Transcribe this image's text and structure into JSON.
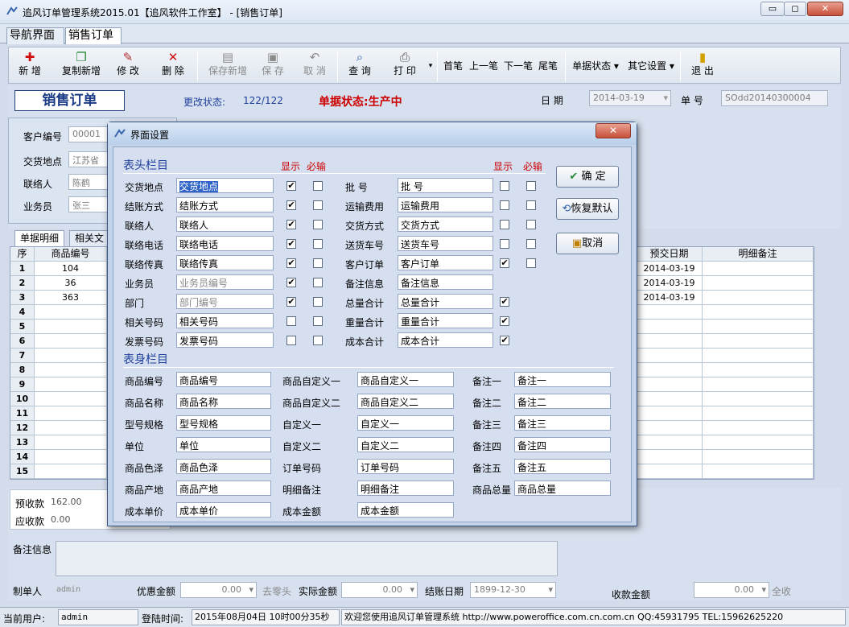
{
  "window": {
    "title": "追风订单管理系统2015.01【追风软件工作室】 - [销售订单]",
    "min": "▭",
    "max": "◻",
    "close": "✕"
  },
  "tabs": [
    "导航界面",
    "销售订单"
  ],
  "toolbar": {
    "add": "新 增",
    "copy_add": "复制新增",
    "edit": "修 改",
    "delete": "删 除",
    "save_add": "保存新增",
    "save": "保 存",
    "cancel": "取 消",
    "query": "查 询",
    "print": "打 印",
    "first": "首笔",
    "prev": "上一笔",
    "next": "下一笔",
    "last": "尾笔",
    "doc_status": "单据状态 ▾",
    "other_settings": "其它设置 ▾",
    "exit": "退 出"
  },
  "header": {
    "order_title": "销售订单",
    "change_status_label": "更改状态:",
    "change_status_value": "122/122",
    "doc_status": "单据状态:生产中",
    "date_label": "日  期",
    "date_value": "2014-03-19",
    "doc_no_label": "单  号",
    "doc_no_value": "SOdd20140300004",
    "fields": [
      {
        "label": "客户编号",
        "value": "00001"
      },
      {
        "label": "交货地点",
        "value": "江苏省"
      },
      {
        "label": "联络人",
        "value": "陈鹤"
      },
      {
        "label": "业务员",
        "value": "张三"
      }
    ]
  },
  "grid": {
    "tabs": [
      "单据明细",
      "相关文"
    ],
    "columns": {
      "seq": "序",
      "code": "商品编号",
      "delivery_date": "预交日期",
      "remark": "明细备注"
    },
    "rows": [
      {
        "seq": "1",
        "code": "104",
        "date": "2014-03-19"
      },
      {
        "seq": "2",
        "code": "36",
        "date": "2014-03-19"
      },
      {
        "seq": "3",
        "code": "363",
        "date": "2014-03-19"
      },
      {
        "seq": "4",
        "code": "",
        "date": ""
      },
      {
        "seq": "5",
        "code": "",
        "date": ""
      },
      {
        "seq": "6",
        "code": "",
        "date": ""
      },
      {
        "seq": "7",
        "code": "",
        "date": ""
      },
      {
        "seq": "8",
        "code": "",
        "date": ""
      },
      {
        "seq": "9",
        "code": "",
        "date": ""
      },
      {
        "seq": "10",
        "code": "",
        "date": ""
      },
      {
        "seq": "11",
        "code": "",
        "date": ""
      },
      {
        "seq": "12",
        "code": "",
        "date": ""
      },
      {
        "seq": "13",
        "code": "",
        "date": ""
      },
      {
        "seq": "14",
        "code": "",
        "date": ""
      },
      {
        "seq": "15",
        "code": "",
        "date": ""
      }
    ]
  },
  "footer": {
    "prepaid_label": "预收款",
    "prepaid_value": "162.00",
    "receivable_label": "应收款",
    "receivable_value": "0.00",
    "remark_label": "备注信息",
    "maker_label": "制单人",
    "maker_value": "admin",
    "discount_label": "优惠金额",
    "discount_value": "0.00",
    "round_label": "去零头",
    "actual_label": "实际金额",
    "actual_value": "0.00",
    "settle_date_label": "结账日期",
    "settle_date_value": "1899-12-30",
    "receipt_label": "收款金额",
    "receipt_value": "0.00",
    "all_receive": "全收"
  },
  "status": {
    "user_label": "当前用户:",
    "user_value": "admin",
    "login_label": "登陆时间:",
    "login_value": "2015年08月04日 10时00分35秒",
    "welcome": "欢迎您使用追风订单管理系统 http://www.poweroffice.com.cn.com.cn QQ:45931795 TEL:15962625220"
  },
  "dialog": {
    "title": "界面设置",
    "close": "✕",
    "head_section": "表头栏目",
    "body_section": "表身栏目",
    "show": "显示",
    "required": "必输",
    "ok": "确 定",
    "restore": "恢复默认",
    "cancel": "取消",
    "left_rows": [
      {
        "label": "交货地点",
        "value": "交货地点",
        "show": true,
        "req": false,
        "selected": true
      },
      {
        "label": "结账方式",
        "value": "结账方式",
        "show": true,
        "req": false
      },
      {
        "label": "联络人",
        "value": "联络人",
        "show": true,
        "req": false
      },
      {
        "label": "联络电话",
        "value": "联络电话",
        "show": true,
        "req": false
      },
      {
        "label": "联络传真",
        "value": "联络传真",
        "show": true,
        "req": false
      },
      {
        "label": "业务员",
        "value": "业务员编号",
        "show": true,
        "req": false,
        "gray": true
      },
      {
        "label": "部门",
        "value": "部门编号",
        "show": true,
        "req": false,
        "gray": true
      },
      {
        "label": "相关号码",
        "value": "相关号码",
        "show": false,
        "req": false
      },
      {
        "label": "发票号码",
        "value": "发票号码",
        "show": false,
        "req": false
      }
    ],
    "right_rows": [
      {
        "label": "批    号",
        "value": "批    号",
        "show": false,
        "req": false,
        "hasReq": true
      },
      {
        "label": "运输费用",
        "value": "运输费用",
        "show": false,
        "req": false,
        "hasReq": true
      },
      {
        "label": "交货方式",
        "value": "交货方式",
        "show": false,
        "req": false,
        "hasReq": true
      },
      {
        "label": "送货车号",
        "value": "送货车号",
        "show": false,
        "req": false,
        "hasReq": true
      },
      {
        "label": "客户订单",
        "value": "客户订单",
        "show": true,
        "req": false,
        "hasReq": true
      },
      {
        "label": "备注信息",
        "value": "备注信息",
        "hasShow": false,
        "hasReq": false
      },
      {
        "label": "总量合计",
        "value": "总量合计",
        "show": true,
        "hasReq": false
      },
      {
        "label": "重量合计",
        "value": "重量合计",
        "show": true,
        "hasReq": false
      },
      {
        "label": "成本合计",
        "value": "成本合计",
        "show": true,
        "hasReq": false
      }
    ],
    "body_col1": [
      {
        "label": "商品编号",
        "value": "商品编号"
      },
      {
        "label": "商品名称",
        "value": "商品名称"
      },
      {
        "label": "型号规格",
        "value": "型号规格"
      },
      {
        "label": "单位",
        "value": "单位"
      },
      {
        "label": "商品色泽",
        "value": "商品色泽"
      },
      {
        "label": "商品产地",
        "value": "商品产地"
      },
      {
        "label": "成本单价",
        "value": "成本单价"
      }
    ],
    "body_col2": [
      {
        "label": "商品自定义一",
        "value": "商品自定义一"
      },
      {
        "label": "商品自定义二",
        "value": "商品自定义二"
      },
      {
        "label": "自定义一",
        "value": "自定义一"
      },
      {
        "label": "自定义二",
        "value": "自定义二"
      },
      {
        "label": "订单号码",
        "value": "订单号码"
      },
      {
        "label": "明细备注",
        "value": "明细备注"
      },
      {
        "label": "成本金额",
        "value": "成本金额"
      }
    ],
    "body_col3": [
      {
        "label": "备注一",
        "value": "备注一"
      },
      {
        "label": "备注二",
        "value": "备注二"
      },
      {
        "label": "备注三",
        "value": "备注三"
      },
      {
        "label": "备注四",
        "value": "备注四"
      },
      {
        "label": "备注五",
        "value": "备注五"
      },
      {
        "label": "商品总量",
        "value": "商品总量"
      }
    ]
  },
  "colors": {
    "accent": "#1f3f9c",
    "status_red": "#cc0000",
    "delete_red": "#d01010"
  }
}
